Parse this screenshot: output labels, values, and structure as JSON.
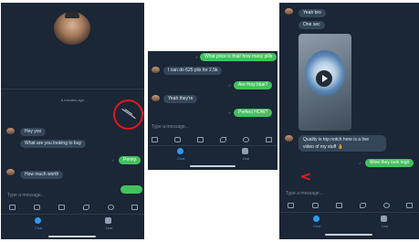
{
  "screen1": {
    "timestamp": "6 minutes ago",
    "messages": [
      {
        "text": "Hey yoo"
      },
      {
        "text": "What are you looking to buy"
      },
      {
        "text": "Penny"
      },
      {
        "text": "How much worth"
      }
    ],
    "input_placeholder": "Type a message...",
    "nav": [
      {
        "label": "Chat"
      },
      {
        "label": "Live"
      }
    ]
  },
  "screen2": {
    "messages": [
      {
        "text": "What price is that/ how many pills"
      },
      {
        "text": "I can do 625 pils for 2.5k"
      },
      {
        "text": "Are they blue?"
      },
      {
        "text": "Yeah they're"
      },
      {
        "text": "Perfect HOW?"
      }
    ],
    "input_placeholder": "Type a message...",
    "nav": [
      {
        "label": "Chat"
      },
      {
        "label": "Live"
      }
    ]
  },
  "screen3": {
    "messages": [
      {
        "text": "Yeah bro"
      },
      {
        "text": "One sec"
      },
      {
        "text": "Quality is top notch here is a live"
      },
      {
        "text": "video of my stuff 👌"
      },
      {
        "text": "Wow they look legit"
      }
    ],
    "input_placeholder": "Type a message...",
    "nav": [
      {
        "label": "Chat"
      },
      {
        "label": "Live"
      }
    ]
  },
  "colors": {
    "background": "#1b2636",
    "incoming_bubble": "#34465a",
    "outgoing_bubble": "#43c15e",
    "annotation": "#e0191f",
    "nav_active": "#2f9bf0"
  },
  "icons": [
    "camera-icon",
    "gif-icon",
    "sticker-icon",
    "emoji-icon",
    "keyboard-icon",
    "photo-icon",
    "chat-icon",
    "live-icon",
    "play-icon"
  ]
}
